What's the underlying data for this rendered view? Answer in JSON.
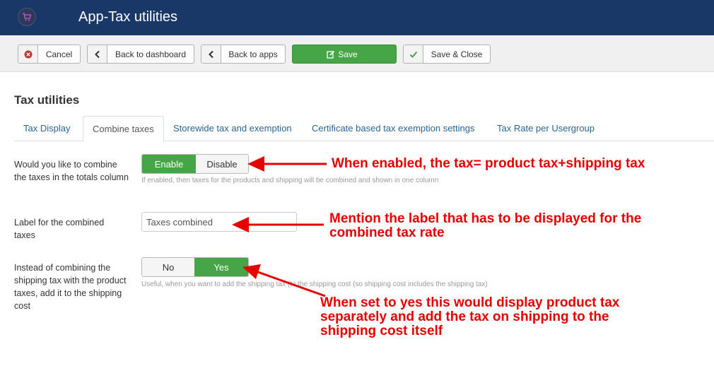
{
  "header": {
    "title": "App-Tax utilities"
  },
  "toolbar": {
    "cancel_label": "Cancel",
    "back_dashboard_label": "Back to dashboard",
    "back_apps_label": "Back to apps",
    "save_label": "Save",
    "save_close_label": "Save & Close"
  },
  "page": {
    "title": "Tax utilities"
  },
  "tabs": [
    {
      "label": "Tax Display",
      "active": false
    },
    {
      "label": "Combine taxes",
      "active": true
    },
    {
      "label": "Storewide tax and exemption",
      "active": false
    },
    {
      "label": "Certificate based tax exemption settings",
      "active": false
    },
    {
      "label": "Tax Rate per Usergroup",
      "active": false
    }
  ],
  "fields": {
    "combine": {
      "label": "Would you like to combine the taxes in the totals column",
      "options": [
        "Enable",
        "Disable"
      ],
      "selected": "Enable",
      "help": "If enabled, then taxes for the products and shipping will be combined and shown in one column"
    },
    "label_combined": {
      "label": "Label for the combined taxes",
      "value": "Taxes combined"
    },
    "shipping": {
      "label": "Instead of combining the shipping tax with the product taxes, add it to the shipping cost",
      "options": [
        "No",
        "Yes"
      ],
      "selected": "Yes",
      "help": "Useful, when you want to add the shipping tax (to the shipping cost (so shipping cost includes the shipping tax)"
    }
  },
  "annotations": {
    "note1": "When enabled, the tax= product tax+shipping tax",
    "note2": "Mention the label that has to be displayed for the combined tax rate",
    "note3": "When set to yes this would display product tax separately and add the tax on shipping to the shipping cost itself"
  },
  "colors": {
    "header": "#1a3867",
    "accent_green": "#46a546",
    "annotation_red": "#e60000",
    "link": "#2a6496"
  },
  "icons": {
    "logo": "shopping-cart-icon",
    "cancel": "cancel-circle-icon",
    "back": "chevron-left-icon",
    "save": "edit-icon",
    "save_close": "checkmark-icon"
  }
}
